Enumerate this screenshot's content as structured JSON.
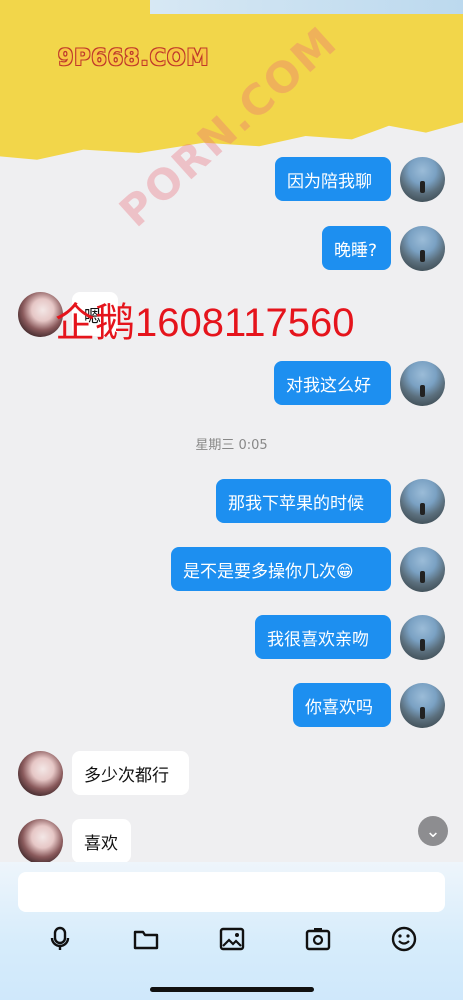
{
  "watermark": {
    "logo": "9P668.COM",
    "diagonal": "PORN.COM"
  },
  "overlay_text": "企鹅1608117560",
  "timestamp": "星期三 0:05",
  "messages": [
    {
      "side": "me",
      "text": "因为陪我聊"
    },
    {
      "side": "me",
      "text": "晚睡?"
    },
    {
      "side": "her",
      "text": "嗯"
    },
    {
      "side": "me",
      "text": "对我这么好"
    },
    {
      "side": "me",
      "text": "那我下苹果的时候"
    },
    {
      "side": "me",
      "text": "是不是要多操你几次😁"
    },
    {
      "side": "me",
      "text": "我很喜欢亲吻"
    },
    {
      "side": "me",
      "text": "你喜欢吗"
    },
    {
      "side": "her",
      "text": "多少次都行"
    },
    {
      "side": "her",
      "text": "喜欢"
    }
  ],
  "toolbar": {
    "icons": [
      "microphone-icon",
      "folder-icon",
      "image-icon",
      "camera-icon",
      "emoji-icon"
    ]
  },
  "scroll_down_icon": "⌄"
}
